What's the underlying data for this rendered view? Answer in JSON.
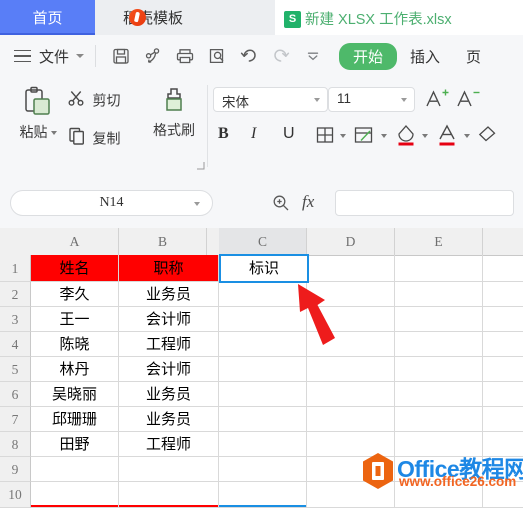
{
  "window": {
    "tabs": [
      {
        "label": "首页",
        "icon": "home-tab",
        "active": true
      },
      {
        "label": "稻壳模板",
        "icon": "docer-leaf-icon",
        "active": false
      },
      {
        "label": "新建 XLSX 工作表.xlsx",
        "icon": "xlsx-sheet-icon",
        "badge": "S",
        "active": false
      }
    ]
  },
  "menubar": {
    "menu_icon": "hamburger-icon",
    "file_label": "文件",
    "file_caret": "chevron-down-icon",
    "quick_access": [
      {
        "name": "save-icon",
        "label": "保存"
      },
      {
        "name": "share-output-icon",
        "label": "输出"
      },
      {
        "name": "print-icon",
        "label": "打印"
      },
      {
        "name": "print-preview-icon",
        "label": "打印预览"
      },
      {
        "name": "undo-icon",
        "label": "撤销"
      },
      {
        "name": "redo-icon",
        "label": "恢复"
      },
      {
        "name": "customize-quick-access-icon",
        "label": "自定义"
      }
    ],
    "ribbon_tabs": [
      {
        "label": "开始",
        "active": true
      },
      {
        "label": "插入",
        "active": false
      },
      {
        "label": "页",
        "active": false
      }
    ]
  },
  "ribbon": {
    "clipboard": {
      "paste_label": "粘贴",
      "paste_icon": "paste-clipboard-icon",
      "cut_label": "剪切",
      "cut_icon": "scissors-icon",
      "copy_label": "复制",
      "copy_icon": "copy-pages-icon",
      "format_painter_label": "格式刷",
      "format_painter_icon": "format-painter-icon",
      "dialog_launcher_icon": "dialog-launcher-icon"
    },
    "font": {
      "font_name_value": "宋体",
      "font_size_value": "11",
      "font_name_caret": "chevron-down-icon",
      "font_size_caret": "chevron-down-icon",
      "grow_font_icon": "increase-font-size-icon",
      "shrink_font_icon": "decrease-font-size-icon",
      "bold_label": "B",
      "italic_label": "I",
      "underline_label": "U",
      "borders_icon": "borders-icon",
      "merge_cells_icon": "merge-cells-icon",
      "fill_color_icon": "fill-color-icon",
      "font_color_icon": "font-color-icon",
      "clear_format_icon": "clear-format-eraser-icon",
      "fill_color_swatch": "#e60012",
      "font_color_swatch": "#e60012"
    }
  },
  "formula_bar": {
    "name_box_value": "N14",
    "name_box_caret": "chevron-down-icon",
    "search_icon": "search-function-icon",
    "fx_label": "fx",
    "formula_value": "",
    "formula_placeholder": ""
  },
  "sheet": {
    "columns": [
      "A",
      "B",
      "C",
      "D",
      "E"
    ],
    "rows": [
      "1",
      "2",
      "3",
      "4",
      "5",
      "6",
      "7",
      "8",
      "9",
      "10"
    ],
    "selected_cell": "C1",
    "selected_cell_value": "标识",
    "selected_column": "C",
    "header_row_fill": "#ff0000",
    "selection_border_color": "#1a8fe3",
    "header_marker_color": "#ff0000",
    "data": [
      {
        "A": "姓名",
        "B": "职称",
        "C": "标识",
        "D": "",
        "E": "",
        "header": true
      },
      {
        "A": "李久",
        "B": "业务员",
        "C": "",
        "D": "",
        "E": ""
      },
      {
        "A": "王一",
        "B": "会计师",
        "C": "",
        "D": "",
        "E": ""
      },
      {
        "A": "陈晓",
        "B": "工程师",
        "C": "",
        "D": "",
        "E": ""
      },
      {
        "A": "林丹",
        "B": "会计师",
        "C": "",
        "D": "",
        "E": ""
      },
      {
        "A": "吴晓丽",
        "B": "业务员",
        "C": "",
        "D": "",
        "E": ""
      },
      {
        "A": "邱珊珊",
        "B": "业务员",
        "C": "",
        "D": "",
        "E": ""
      },
      {
        "A": "田野",
        "B": "工程师",
        "C": "",
        "D": "",
        "E": ""
      },
      {
        "A": "",
        "B": "",
        "C": "",
        "D": "",
        "E": ""
      },
      {
        "A": "",
        "B": "",
        "C": "",
        "D": "",
        "E": ""
      }
    ]
  },
  "annotation": {
    "arrow_color": "#ee1c1c",
    "arrow_name": "red-pointer-arrow"
  },
  "watermark": {
    "title": "Office教程网",
    "url": "www.office26.com",
    "logo_icon": "office-hexagon-logo",
    "title_color": "#1e88e5",
    "url_color": "#f26522"
  }
}
